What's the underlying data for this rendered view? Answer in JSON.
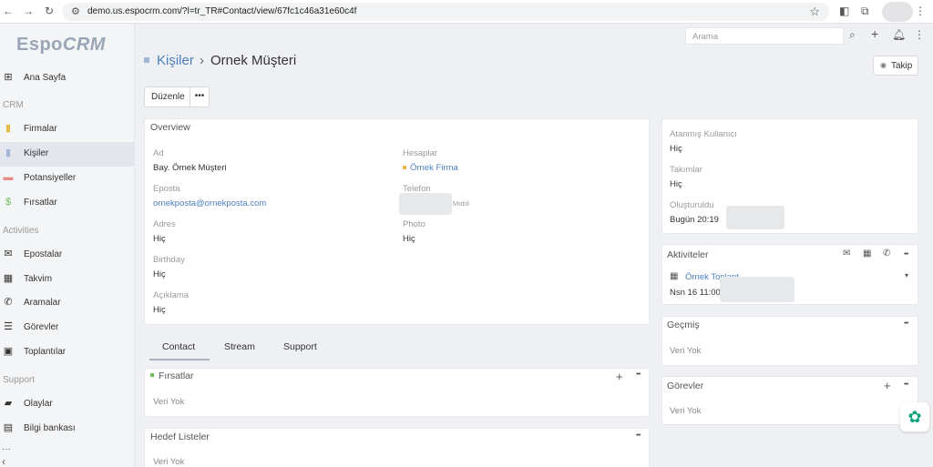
{
  "browser": {
    "url": "demo.us.espocrm.com/?l=tr_TR#Contact/view/67fc1c46a31e60c4f"
  },
  "logo": {
    "part1": "Espo",
    "part2": "CRM"
  },
  "sidebar": {
    "items": [
      {
        "label": "Ana Sayfa",
        "icon": "grid-icon"
      },
      {
        "label": "Firmalar",
        "icon": "building-icon"
      },
      {
        "label": "Kişiler",
        "icon": "contact-card-icon",
        "active": true
      },
      {
        "label": "Potansiyeller",
        "icon": "lead-card-icon"
      },
      {
        "label": "Fırsatlar",
        "icon": "dollar-icon"
      },
      {
        "label": "Epostalar",
        "icon": "envelope-icon"
      },
      {
        "label": "Takvim",
        "icon": "calendar-icon"
      },
      {
        "label": "Aramalar",
        "icon": "phone-icon"
      },
      {
        "label": "Görevler",
        "icon": "tasks-icon"
      },
      {
        "label": "Toplantılar",
        "icon": "meeting-icon"
      },
      {
        "label": "Olaylar",
        "icon": "briefcase-icon"
      },
      {
        "label": "Bilgi bankası",
        "icon": "book-icon"
      }
    ],
    "groups": {
      "crm": "CRM",
      "activities": "Activities",
      "support": "Support"
    }
  },
  "topbar": {
    "search_placeholder": "Arama"
  },
  "header": {
    "breadcrumb_link": "Kişiler",
    "separator": "›",
    "title": "Ornek Müşteri",
    "follow_label": "Takip",
    "edit_label": "Düzenle",
    "more_label": "•••"
  },
  "overview": {
    "title": "Overview",
    "fields": {
      "ad_label": "Ad",
      "ad_value": "Bay. Örnek Müşteri",
      "hesaplar_label": "Hesaplar",
      "hesaplar_value": "Örnek Firma",
      "eposta_label": "Eposta",
      "eposta_value": "ornekposta@ornekposta.com",
      "telefon_label": "Telefon",
      "telefon_type": "Mobil",
      "adres_label": "Adres",
      "adres_value": "Hiç",
      "photo_label": "Photo",
      "photo_value": "Hiç",
      "birthday_label": "Birthday",
      "birthday_value": "Hiç",
      "aciklama_label": "Açıklama",
      "aciklama_value": "Hiç"
    }
  },
  "tabs": [
    "Contact",
    "Stream",
    "Support"
  ],
  "firsatlar": {
    "title": "Fırsatlar",
    "empty": "Veri Yok",
    "add": "+",
    "more": "•••"
  },
  "hedef": {
    "title": "Hedef Listeler",
    "empty": "Veri Yok",
    "more": "•••"
  },
  "side": {
    "assigned_label": "Atanmış Kullanıcı",
    "assigned_value": "Hiç",
    "teams_label": "Takımlar",
    "teams_value": "Hiç",
    "created_label": "Oluşturuldu",
    "created_value": "Bugün 20:19"
  },
  "activities": {
    "title": "Aktiviteler",
    "item_title": "Örnek Toplant",
    "item_date": "Nsn 16 11:00"
  },
  "history": {
    "title": "Geçmiş",
    "empty": "Veri Yok",
    "more": "•••"
  },
  "tasks": {
    "title": "Görevler",
    "empty": "Veri Yok",
    "add": "+",
    "more": "•••"
  },
  "colors": {
    "accent": "#4b7fbf",
    "sidebar_bg": "#f4f5f7",
    "page_bg": "#eef0f3"
  }
}
